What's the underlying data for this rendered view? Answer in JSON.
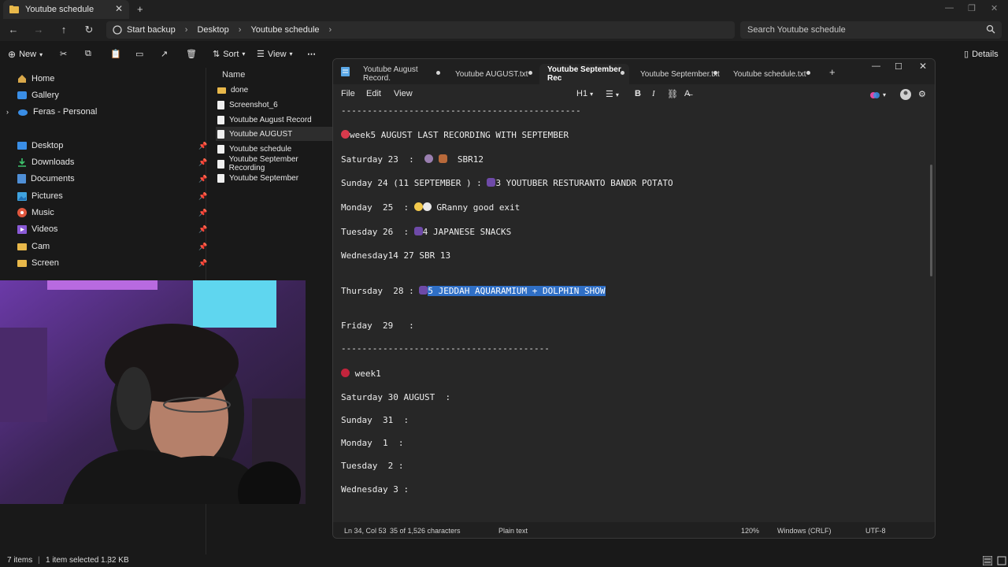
{
  "explorer": {
    "title": "Youtube schedule",
    "breadcrumb": [
      "Start backup",
      "Desktop",
      "Youtube schedule"
    ],
    "search_placeholder": "Search Youtube schedule",
    "commands": {
      "new": "New",
      "sort": "Sort",
      "view": "View",
      "details": "Details"
    },
    "sidebar": {
      "top_items": [
        {
          "label": "Home",
          "icon": "home-icon"
        },
        {
          "label": "Gallery",
          "icon": "gallery-icon"
        },
        {
          "label": "Feras - Personal",
          "icon": "cloud-icon"
        }
      ],
      "quick_access": [
        {
          "label": "Desktop",
          "icon": "desktop-icon"
        },
        {
          "label": "Downloads",
          "icon": "download-icon"
        },
        {
          "label": "Documents",
          "icon": "documents-icon"
        },
        {
          "label": "Pictures",
          "icon": "pictures-icon"
        },
        {
          "label": "Music",
          "icon": "music-icon"
        },
        {
          "label": "Videos",
          "icon": "videos-icon"
        },
        {
          "label": "Cam",
          "icon": "folder-icon"
        },
        {
          "label": "Screen",
          "icon": "folder-icon"
        }
      ]
    },
    "files": {
      "column_name": "Name",
      "rows": [
        {
          "name": "done",
          "type": "folder"
        },
        {
          "name": "Screenshot_6",
          "type": "file"
        },
        {
          "name": "Youtube August Record",
          "type": "file"
        },
        {
          "name": "Youtube AUGUST",
          "type": "file"
        },
        {
          "name": "Youtube schedule",
          "type": "file"
        },
        {
          "name": "Youtube September Recording",
          "type": "file"
        },
        {
          "name": "Youtube September",
          "type": "file"
        }
      ]
    },
    "status": {
      "item_count": "7 items",
      "selected": "1 item selected  1.32 KB"
    }
  },
  "notepad": {
    "tabs": [
      "Youtube August Record.",
      "Youtube AUGUST.txt",
      "Youtube September Rec",
      "Youtube September.txt",
      "Youtube schedule.txt"
    ],
    "active_tab": 2,
    "menu": [
      "File",
      "Edit",
      "View"
    ],
    "heading_select": "H1",
    "lines": {
      "divider1": "----------------------------------------------",
      "week5": "week5 AUGUST LAST RECORDING WITH SEPTEMBER",
      "sat23": "Saturday 23  :",
      "sat23_text": "SBR12",
      "sun24": "Sunday 24 (11 SEPTEMBER ) :",
      "sun24_text": "3 YOUTUBER RESTURANTO BANDR POTATO",
      "mon25": "Monday  25  :",
      "mon25_text": "GRanny good exit",
      "tue26": "Tuesday 26  :",
      "tue26_text": "4 JAPANESE SNACKS",
      "wed27": "Wednesday14 27 SBR 13",
      "thu28": "Thursday  28 :",
      "thu28_text": "5 JEDDAH AQUARAMIUM + DOLPHIN SHOW",
      "fri29": "Friday  29   :",
      "divider2": "----------------------------------------",
      "week1": "week1",
      "sat30": "Saturday 30 AUGUST  :",
      "sun31": "Sunday  31  :",
      "mon1": "Monday  1  :",
      "tue2": "Tuesday  2 :",
      "wed3": "Wednesday 3 :"
    },
    "status": {
      "position": "Ln 34, Col 53",
      "chars": "35 of 1,526 characters",
      "type": "Plain text",
      "zoom": "120%",
      "eol": "Windows (CRLF)",
      "encoding": "UTF-8"
    }
  },
  "colors": {
    "selection": "#2f6fc6",
    "background": "#191919",
    "editor": "#272727"
  }
}
